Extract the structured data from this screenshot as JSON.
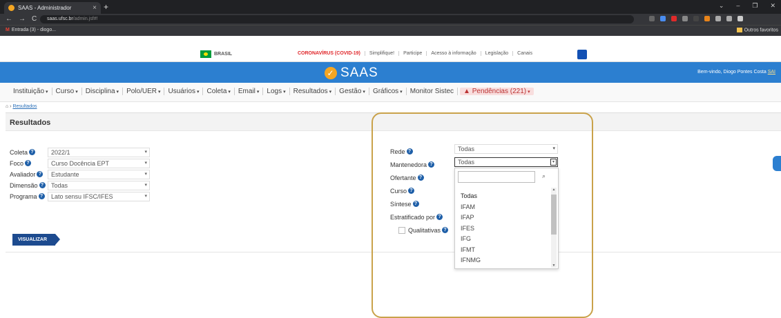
{
  "browser": {
    "tab_title": "SAAS - Administrador",
    "tab_close": "×",
    "new_tab": "+",
    "url_host": "saas.ufsc.br",
    "url_path": "/admin.jsf#!",
    "bookmark": "Entrada (3) - diogo...",
    "bookmark_icon": "M",
    "other_bookmarks": "Outros favoritos",
    "window_controls": [
      "⌄",
      "–",
      "❐",
      "✕"
    ],
    "nav": [
      "←",
      "→",
      "C"
    ]
  },
  "gov": {
    "country": "BRASIL",
    "links": [
      "CORONAVÍRUS (COVID-19)",
      "Simplifique!",
      "Participe",
      "Acesso à informação",
      "Legislação",
      "Canais"
    ]
  },
  "header": {
    "logo": "SAAS",
    "welcome_prefix": "Bem-vindo, Diogo Pontes Costa",
    "welcome_link": "SAI"
  },
  "menu": {
    "items": [
      "Instituição",
      "Curso",
      "Disciplina",
      "Polo/UER",
      "Usuários",
      "Coleta",
      "Email",
      "Logs",
      "Resultados",
      "Gestão",
      "Gráficos",
      "Monitor Sistec"
    ],
    "pending": "▲ Pendências (221)"
  },
  "breadcrumb": {
    "home": "⌂ ›",
    "current": "Resultados"
  },
  "panel": {
    "title": "Resultados",
    "visualize_button": "VISUALIZAR"
  },
  "left_form": [
    {
      "label": "Coleta",
      "value": "2022/1"
    },
    {
      "label": "Foco",
      "value": "Curso Docência EPT"
    },
    {
      "label": "Avaliador",
      "value": "Estudante"
    },
    {
      "label": "Dimensão",
      "value": "Todas"
    },
    {
      "label": "Programa",
      "value": "Lato sensu IFSC/IFES"
    }
  ],
  "right_form": {
    "rede": {
      "label": "Rede",
      "value": "Todas"
    },
    "mantenedora": {
      "label": "Mantenedora",
      "value": "Todas"
    },
    "ofertante": {
      "label": "Ofertante"
    },
    "curso": {
      "label": "Curso"
    },
    "sintese": {
      "label": "Síntese"
    },
    "estratificado": {
      "label": "Estratificado por"
    },
    "qualitativas": {
      "label": "Qualitativas"
    }
  },
  "dropdown_options": [
    "Todas",
    "IFAM",
    "IFAP",
    "IFES",
    "IFG",
    "IFMT",
    "IFNMG"
  ],
  "colors": {
    "header_blue": "#2c7fd0",
    "highlight": "#c9a24a",
    "button_blue": "#1d4b8f"
  }
}
